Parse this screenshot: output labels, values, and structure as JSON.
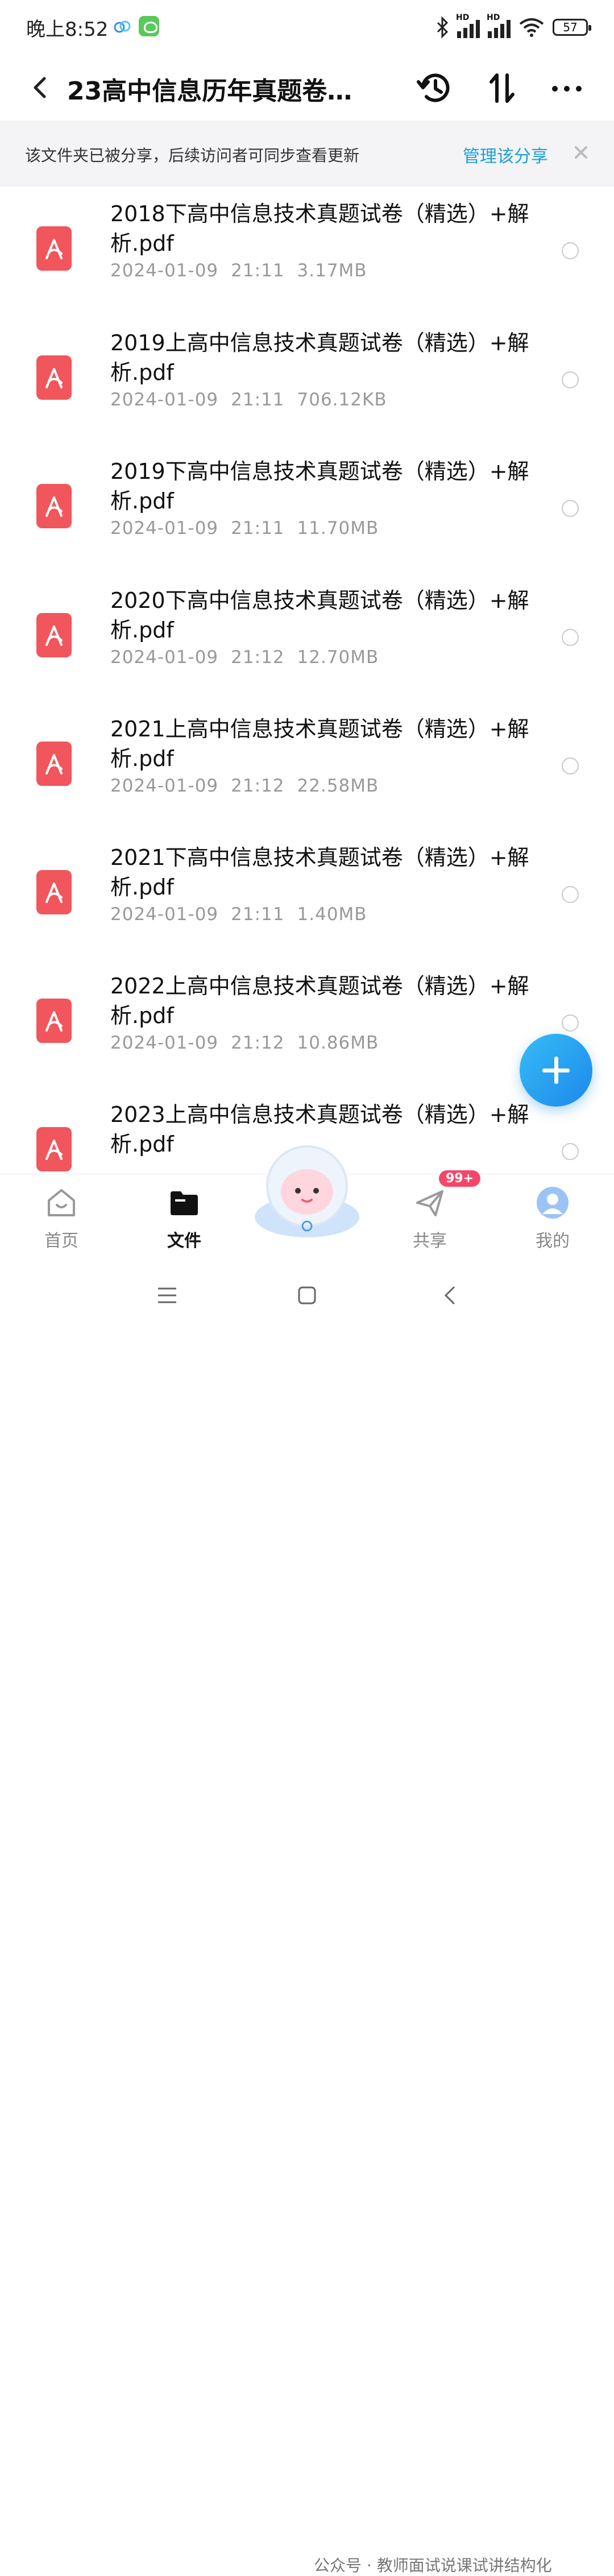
{
  "status_bar": {
    "time": "晚上8:52",
    "battery": "57",
    "signal_labels": [
      "HD",
      "HD"
    ]
  },
  "header": {
    "title": "23高中信息历年真题卷（...",
    "back_icon": "chevron-left-icon",
    "history_icon": "history-icon",
    "sort_icon": "sort-icon",
    "more_icon": "more-dots-icon"
  },
  "share_banner": {
    "text": "该文件夹已被分享，后续访问者可同步查看更新",
    "action": "管理该分享",
    "action_color": "#1ca0d6"
  },
  "files": [
    {
      "name": "2018下高中信息技术真题试卷（精选）+解析.pdf",
      "date": "2024-01-09",
      "time": "21:11",
      "size": "3.17MB"
    },
    {
      "name": "2019上高中信息技术真题试卷（精选）+解析.pdf",
      "date": "2024-01-09",
      "time": "21:11",
      "size": "706.12KB"
    },
    {
      "name": "2019下高中信息技术真题试卷（精选）+解析.pdf",
      "date": "2024-01-09",
      "time": "21:11",
      "size": "11.70MB"
    },
    {
      "name": "2020下高中信息技术真题试卷（精选）+解析.pdf",
      "date": "2024-01-09",
      "time": "21:12",
      "size": "12.70MB"
    },
    {
      "name": "2021上高中信息技术真题试卷（精选）+解析.pdf",
      "date": "2024-01-09",
      "time": "21:12",
      "size": "22.58MB"
    },
    {
      "name": "2021下高中信息技术真题试卷（精选）+解析.pdf",
      "date": "2024-01-09",
      "time": "21:11",
      "size": "1.40MB"
    },
    {
      "name": "2022上高中信息技术真题试卷（精选）+解析.pdf",
      "date": "2024-01-09",
      "time": "21:12",
      "size": "10.86MB"
    },
    {
      "name": "2023上高中信息技术真题试卷（精选）+解析.pdf",
      "date": "",
      "time": "",
      "size": ""
    }
  ],
  "pdf_color": "#f0565b",
  "bottom_nav": {
    "home": "首页",
    "files": "文件",
    "share": "共享",
    "me": "我的",
    "share_badge": "99+"
  },
  "watermark": "公众号 · 教师面试说课试讲结构化"
}
